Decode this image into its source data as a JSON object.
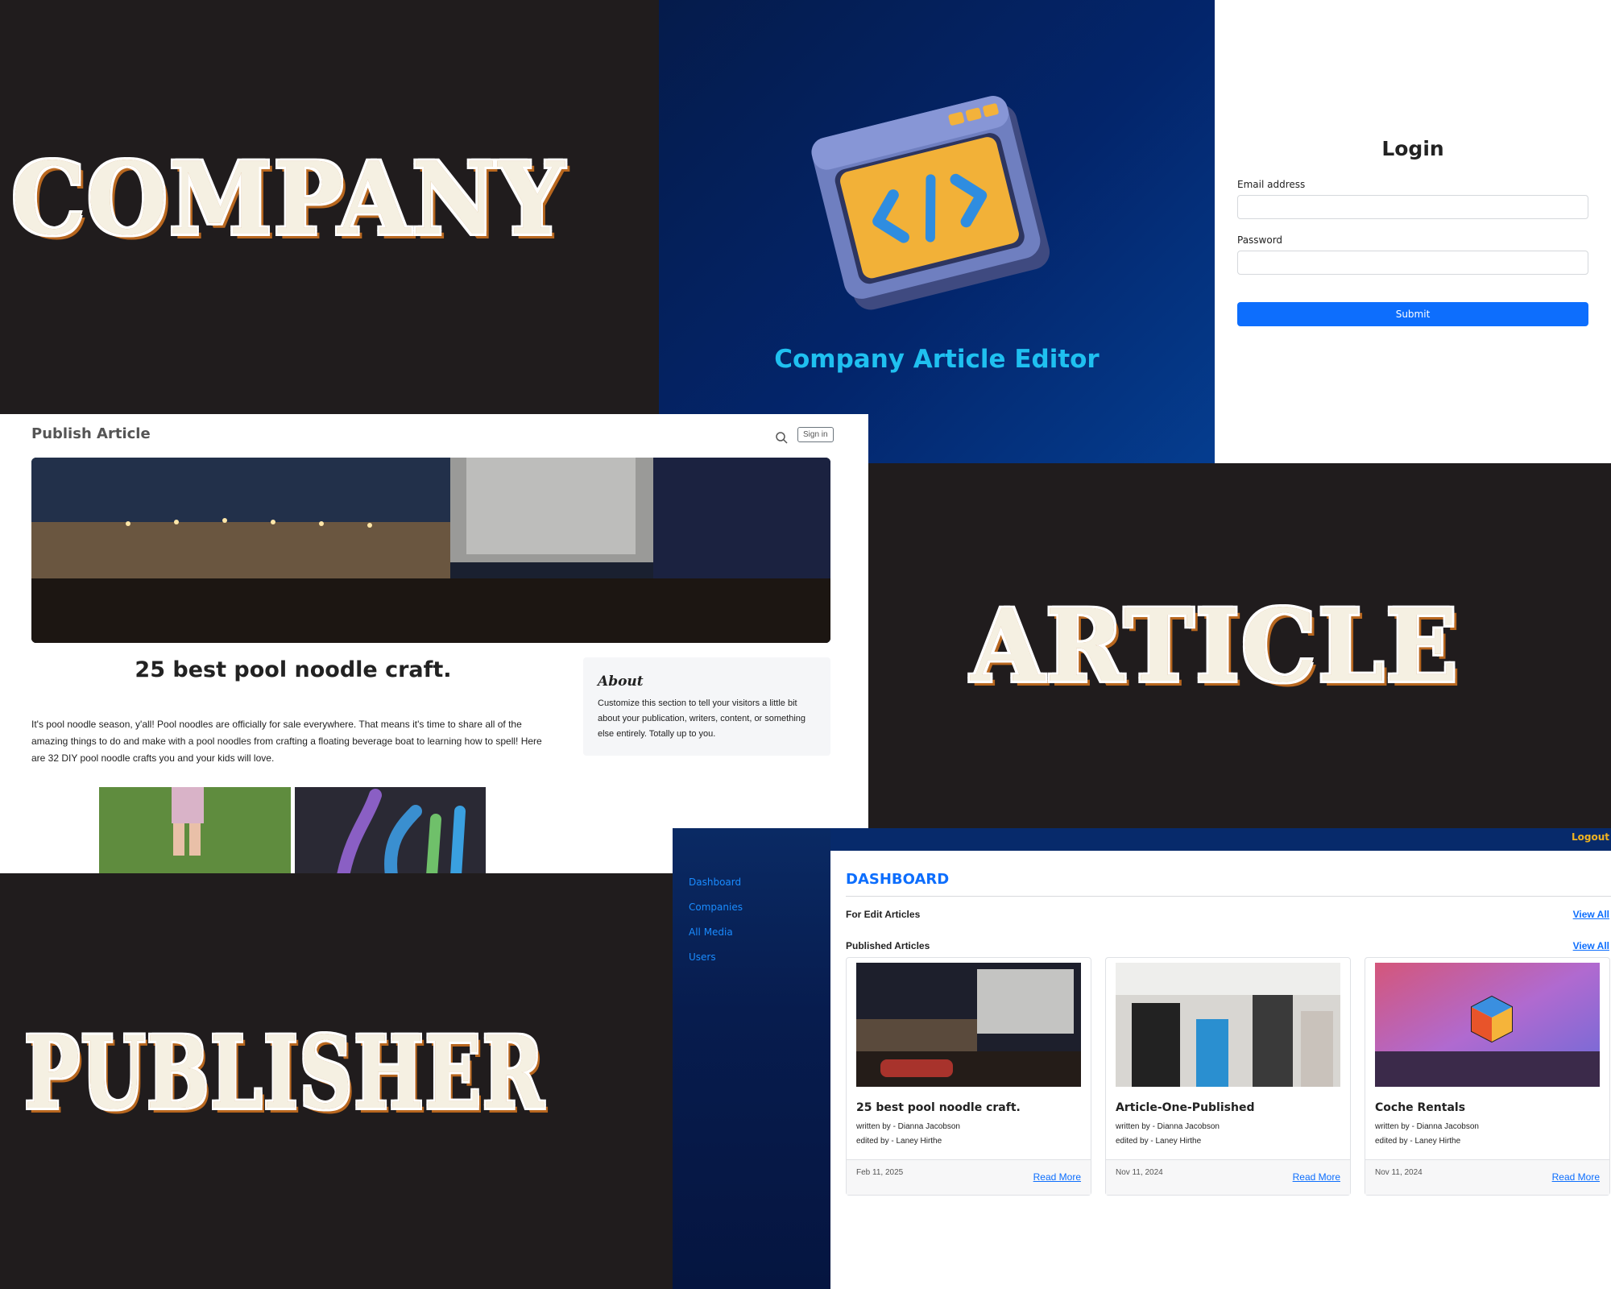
{
  "words": {
    "company": "COMPANY",
    "article": "ARTICLE",
    "publisher": "PUBLISHER"
  },
  "hero": {
    "title": "Company Article Editor",
    "icon": "code-window-icon"
  },
  "login": {
    "title": "Login",
    "email_label": "Email address",
    "email_value": "",
    "password_label": "Password",
    "password_value": "",
    "submit_label": "Submit"
  },
  "publish": {
    "brand": "Publish Article",
    "signin_label": "Sign in",
    "article_title": "25 best pool noodle craft.",
    "article_body": "It's pool noodle season, y'all! Pool noodles are officially for sale everywhere. That means it's time to share all of the amazing things to do and make with a pool noodles from crafting a floating beverage boat to learning how to spell! Here are 32 DIY pool noodle crafts you and your kids will love.",
    "about_title": "About",
    "about_text": "Customize this section to tell your visitors a little bit about your publication, writers, content, or something else entirely. Totally up to you."
  },
  "dashboard": {
    "logout": "Logout",
    "sidebar": [
      "Dashboard",
      "Companies",
      "All Media",
      "Users"
    ],
    "title": "DASHBOARD",
    "for_edit": "For Edit Articles",
    "published": "Published Articles",
    "view_all": "View All",
    "cards": [
      {
        "title": "25 best pool noodle craft.",
        "written": "written by - Dianna Jacobson",
        "edited": "edited by - Laney Hirthe",
        "date": "Feb 11, 2025",
        "read": "Read More"
      },
      {
        "title": "Article-One-Published",
        "written": "written by - Dianna Jacobson",
        "edited": "edited by - Laney Hirthe",
        "date": "Nov 11, 2024",
        "read": "Read More"
      },
      {
        "title": "Coche Rentals",
        "written": "written by - Dianna Jacobson",
        "edited": "edited by - Laney Hirthe",
        "date": "Nov 11, 2024",
        "read": "Read More"
      }
    ]
  },
  "colors": {
    "background": "#201c1d",
    "accent": "#0d6efd",
    "word_fill": "#f5f0e2",
    "word_outline": "#b8671f",
    "hero_title": "#1fc0f0",
    "logout": "#f0b320"
  }
}
